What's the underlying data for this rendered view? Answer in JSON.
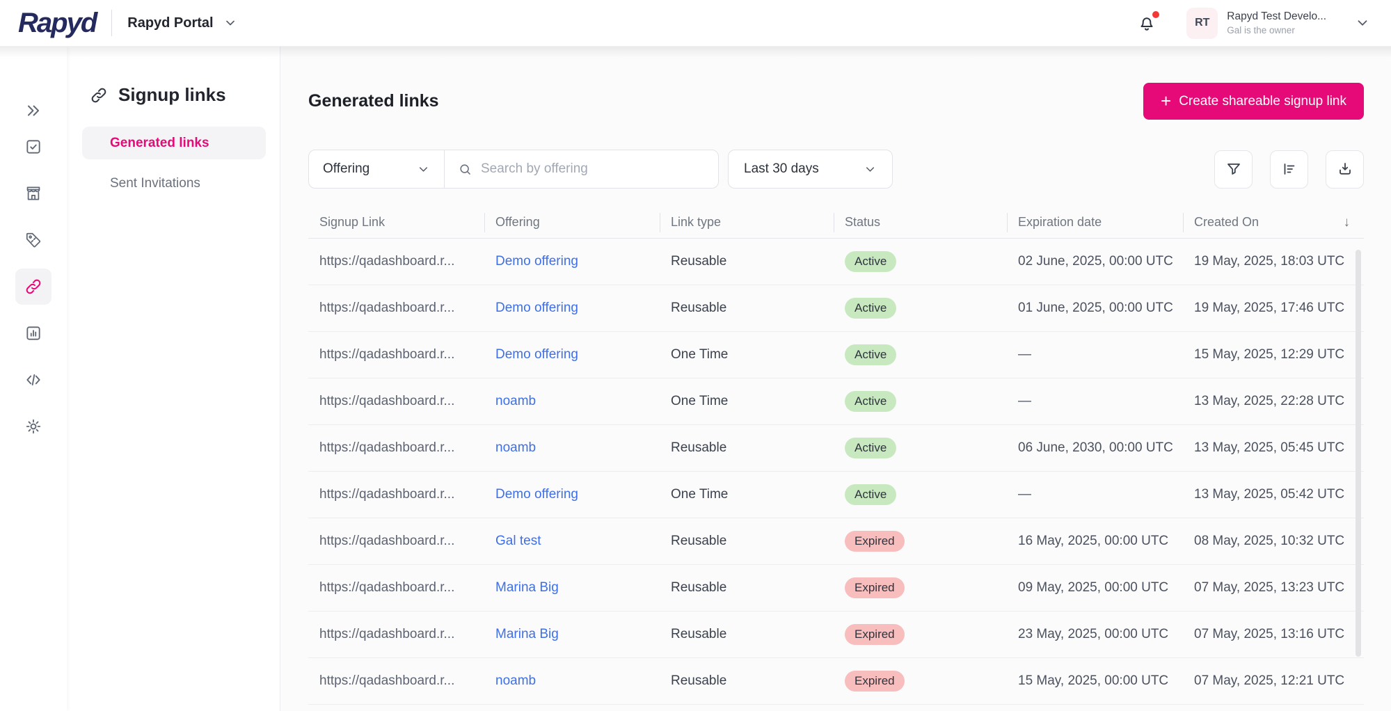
{
  "topbar": {
    "logo": "Rapyd",
    "portal": "Rapyd Portal",
    "account": {
      "initials": "RT",
      "name": "Rapyd Test Develo...",
      "subtitle": "Gal is the owner"
    },
    "notifications": {
      "has_unread": true
    }
  },
  "icon_rail": {
    "items": [
      "collapse-icon",
      "tasks-icon",
      "store-icon",
      "tag-icon",
      "link-icon",
      "reports-icon",
      "developers-icon",
      "settings-icon"
    ],
    "active": "link-icon"
  },
  "sidebar": {
    "title": "Signup links",
    "items": [
      {
        "label": "Generated links",
        "active": true
      },
      {
        "label": "Sent Invitations",
        "active": false
      }
    ]
  },
  "main": {
    "title": "Generated links",
    "create_button_label": "Create shareable signup link",
    "plus_glyph": "+",
    "filters": {
      "offering_label": "Offering",
      "search_placeholder": "Search by offering",
      "date_range": "Last 30 days"
    },
    "table": {
      "columns": [
        {
          "label": "Signup Link"
        },
        {
          "label": "Offering"
        },
        {
          "label": "Link type"
        },
        {
          "label": "Status"
        },
        {
          "label": "Expiration date"
        },
        {
          "label": "Created On",
          "sorted": "desc",
          "sort_glyph": "↓"
        }
      ],
      "rows": [
        {
          "link": "https://qadashboard.r...",
          "offering": "Demo offering",
          "type": "Reusable",
          "status": "Active",
          "expiration": "02 June, 2025, 00:00 UTC",
          "created": "19 May, 2025, 18:03 UTC"
        },
        {
          "link": "https://qadashboard.r...",
          "offering": "Demo offering",
          "type": "Reusable",
          "status": "Active",
          "expiration": "01 June, 2025, 00:00 UTC",
          "created": "19 May, 2025, 17:46 UTC"
        },
        {
          "link": "https://qadashboard.r...",
          "offering": "Demo offering",
          "type": "One Time",
          "status": "Active",
          "expiration": "—",
          "created": "15 May, 2025, 12:29 UTC"
        },
        {
          "link": "https://qadashboard.r...",
          "offering": "noamb",
          "type": "One Time",
          "status": "Active",
          "expiration": "—",
          "created": "13 May, 2025, 22:28 UTC"
        },
        {
          "link": "https://qadashboard.r...",
          "offering": "noamb",
          "type": "Reusable",
          "status": "Active",
          "expiration": "06 June, 2030, 00:00 UTC",
          "created": "13 May, 2025, 05:45 UTC"
        },
        {
          "link": "https://qadashboard.r...",
          "offering": "Demo offering",
          "type": "One Time",
          "status": "Active",
          "expiration": "—",
          "created": "13 May, 2025, 05:42 UTC"
        },
        {
          "link": "https://qadashboard.r...",
          "offering": "Gal test",
          "type": "Reusable",
          "status": "Expired",
          "expiration": "16 May, 2025, 00:00 UTC",
          "created": "08 May, 2025, 10:32 UTC"
        },
        {
          "link": "https://qadashboard.r...",
          "offering": "Marina Big",
          "type": "Reusable",
          "status": "Expired",
          "expiration": "09 May, 2025, 00:00 UTC",
          "created": "07 May, 2025, 13:23 UTC"
        },
        {
          "link": "https://qadashboard.r...",
          "offering": "Marina Big",
          "type": "Reusable",
          "status": "Expired",
          "expiration": "23 May, 2025, 00:00 UTC",
          "created": "07 May, 2025, 13:16 UTC"
        },
        {
          "link": "https://qadashboard.r...",
          "offering": "noamb",
          "type": "Reusable",
          "status": "Expired",
          "expiration": "15 May, 2025, 00:00 UTC",
          "created": "07 May, 2025, 12:21 UTC"
        }
      ]
    }
  },
  "colors": {
    "brand_pink": "#E50A77",
    "logo_navy": "#242A5E",
    "link_blue": "#3E6FE8",
    "badge_active_bg": "#C8E9C0",
    "badge_expired_bg": "#F8BDBD",
    "notification_red": "#F23936"
  }
}
